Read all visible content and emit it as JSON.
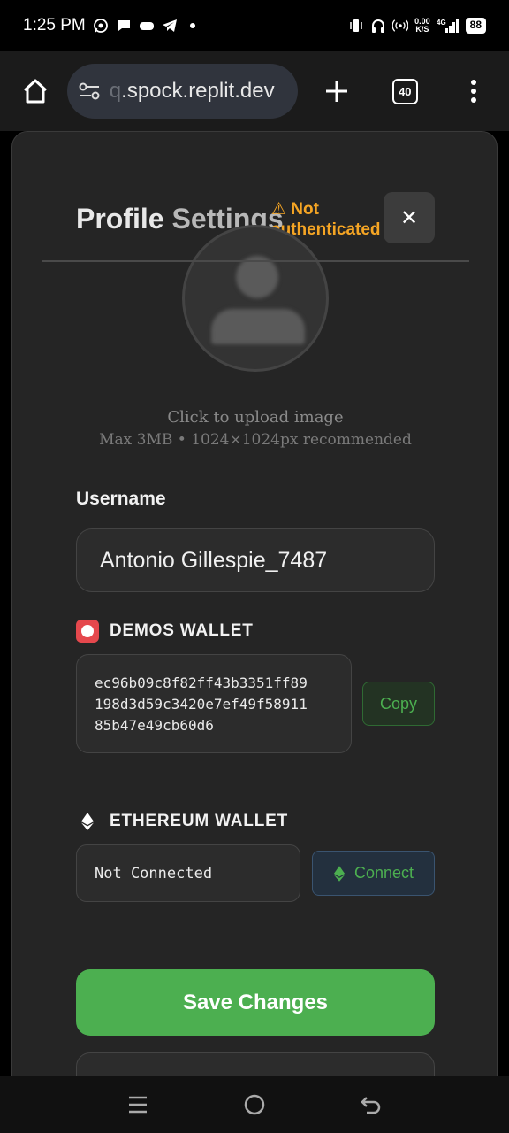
{
  "status_bar": {
    "time": "1:25 PM",
    "net_speed": "0.00",
    "net_unit": "K/S",
    "network": "4G",
    "battery": "88"
  },
  "browser": {
    "url_faded": "q",
    "url": ".spock.replit.dev",
    "tab_count": "40"
  },
  "modal": {
    "title_main": "Profile ",
    "title_dim": "Settings",
    "auth_warning": "⚠ Not authenticated",
    "close_label": "✕"
  },
  "avatar": {
    "upload_text": "Click to upload image",
    "upload_hint": "Max 3MB • 1024×1024px recommended"
  },
  "username": {
    "label": "Username",
    "value": "Antonio Gillespie_7487"
  },
  "demos_wallet": {
    "label": "DEMOS WALLET",
    "address_lines": [
      "ec96b09c8f82ff43b3351ff89",
      "198d3d59c3420e7ef49f58911",
      "85b47e49cb60d6"
    ],
    "copy_label": "Copy"
  },
  "ethereum_wallet": {
    "label": "ETHEREUM WALLET",
    "status": "Not Connected",
    "connect_label": "Connect"
  },
  "actions": {
    "save_label": "Save Changes"
  },
  "colors": {
    "accent_green": "#4caf50",
    "warning": "#f5a524",
    "demos_red": "#e5484d"
  }
}
